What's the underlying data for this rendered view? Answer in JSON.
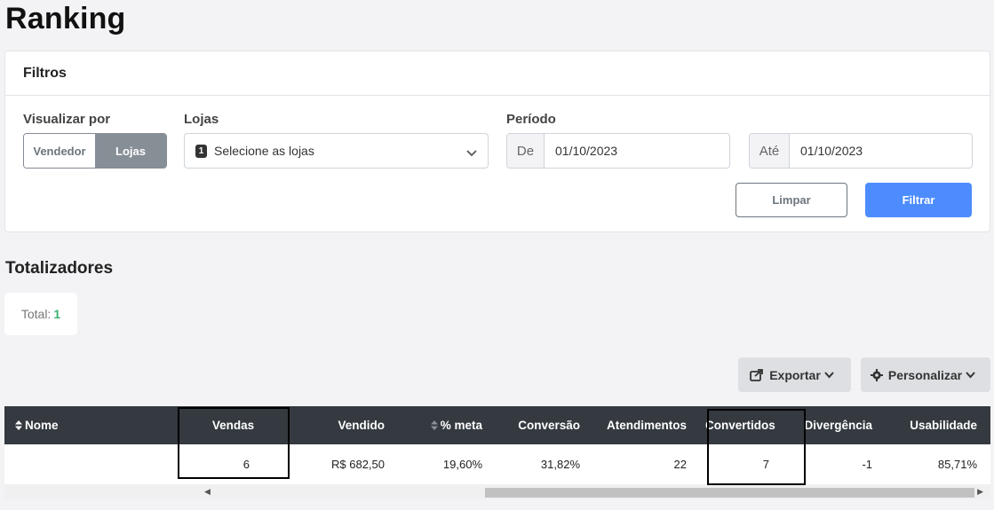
{
  "page": {
    "title": "Ranking"
  },
  "filters": {
    "title": "Filtros",
    "view_by": {
      "label": "Visualizar por",
      "options": [
        "Vendedor",
        "Lojas"
      ],
      "selected": "Lojas"
    },
    "stores": {
      "label": "Lojas",
      "badge": "1",
      "placeholder": "Selecione as lojas"
    },
    "period": {
      "label": "Período",
      "from_label": "De",
      "from_value": "01/10/2023",
      "to_label": "Até",
      "to_value": "01/10/2023"
    },
    "clear_label": "Limpar",
    "filter_label": "Filtrar"
  },
  "totals": {
    "title": "Totalizadores",
    "label": "Total:",
    "value": "1"
  },
  "toolbar": {
    "export_label": "Exportar",
    "customize_label": "Personalizar"
  },
  "table": {
    "headers": [
      "Nome",
      "Vendas",
      "Vendido",
      "% meta",
      "Conversão",
      "Atendimentos",
      "Convertidos",
      "Divergência",
      "Usabilidade"
    ],
    "rows": [
      [
        "",
        "6",
        "R$ 682,50",
        "19,60%",
        "31,82%",
        "22",
        "7",
        "-1",
        "85,71%"
      ]
    ]
  },
  "colors": {
    "header_bg": "#343a40",
    "primary": "#4d8cfd",
    "total_value": "#3cb371"
  }
}
